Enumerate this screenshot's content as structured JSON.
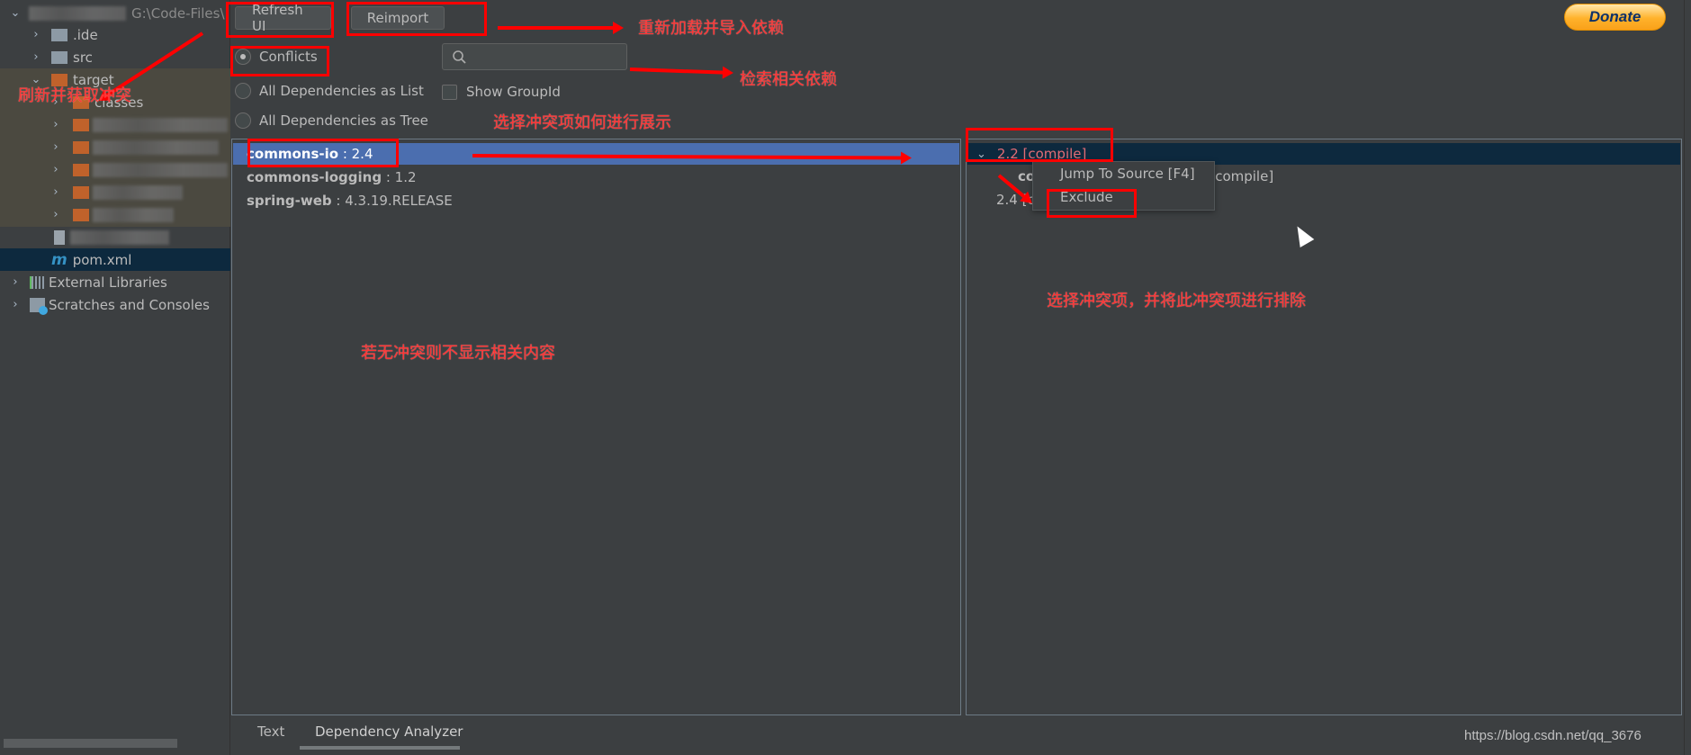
{
  "sidebar": {
    "project_path": "G:\\Code-Files\\",
    "items": [
      {
        "label": ".ide",
        "icon": "folder-icon",
        "color": "#8d9aa5"
      },
      {
        "label": "src",
        "icon": "folder-icon",
        "color": "#8d9aa5"
      },
      {
        "label": "target",
        "icon": "folder-icon",
        "color": "#c0622b"
      },
      {
        "label": "classes",
        "icon": "folder-icon",
        "color": "#c0622b"
      },
      {
        "label": "pom.xml",
        "icon": "maven-icon"
      },
      {
        "label": "External Libraries",
        "icon": "library-icon"
      },
      {
        "label": "Scratches and Consoles",
        "icon": "scratches-icon"
      }
    ]
  },
  "toolbar": {
    "refresh_label": "Refresh UI",
    "reimport_label": "Reimport",
    "donate_label": "Donate",
    "search_placeholder": "",
    "search_value": ""
  },
  "view_modes": {
    "options": [
      "Conflicts",
      "All Dependencies as List",
      "All Dependencies as Tree"
    ],
    "selected": "Conflicts"
  },
  "show_group_id": {
    "label": "Show GroupId",
    "checked": false
  },
  "conflict_list": [
    {
      "name": "commons-io",
      "version": "2.4",
      "selected": true
    },
    {
      "name": "commons-logging",
      "version": "1.2",
      "selected": false
    },
    {
      "name": "spring-web",
      "version": "4.3.19.RELEASE",
      "selected": false
    }
  ],
  "usage_tree": {
    "root": "2.2 [compile]",
    "child_prefix": "co",
    "child_suffix": "compile]",
    "second": "2.4 [c"
  },
  "context_menu": {
    "items": [
      "Jump To Source [F4]",
      "Exclude"
    ]
  },
  "bottom_tabs": {
    "items": [
      "Text",
      "Dependency Analyzer"
    ],
    "active": "Dependency Analyzer"
  },
  "annotations": {
    "refresh": "刷新并获取冲突",
    "reimport": "重新加载并导入依赖",
    "search": "检索相关依赖",
    "view_mode": "选择冲突项如何进行展示",
    "empty": "若无冲突则不显示相关内容",
    "exclude": "选择冲突项，并将此冲突项进行排除"
  },
  "watermark": "https://blog.csdn.net/qq_3676",
  "colors": {
    "selection": "#4b6eaf",
    "tree_selection": "#0d293e",
    "conflict_red": "#e06c75",
    "annotation_red": "#ff0000"
  }
}
